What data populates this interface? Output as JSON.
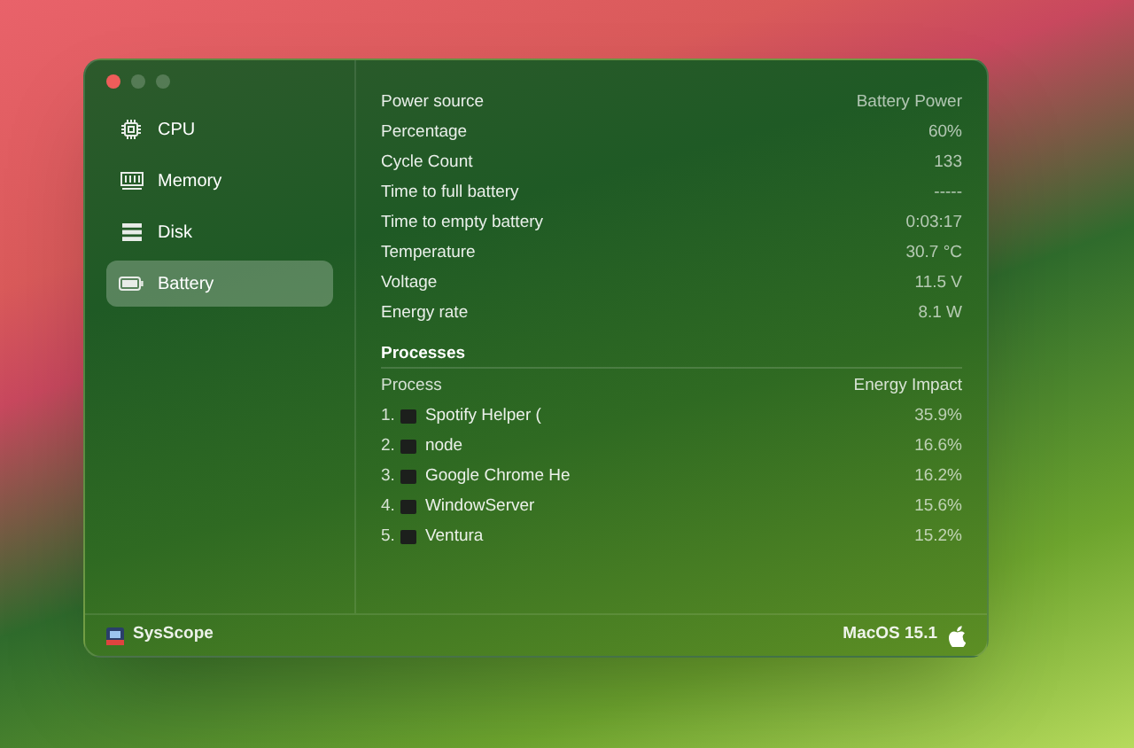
{
  "sidebar": {
    "items": [
      {
        "label": "CPU",
        "kind": "cpu",
        "selected": false
      },
      {
        "label": "Memory",
        "kind": "memory",
        "selected": false
      },
      {
        "label": "Disk",
        "kind": "disk",
        "selected": false
      },
      {
        "label": "Battery",
        "kind": "battery",
        "selected": true
      }
    ]
  },
  "battery_info": [
    {
      "label": "Power source",
      "value": "Battery Power"
    },
    {
      "label": "Percentage",
      "value": "60%"
    },
    {
      "label": "Cycle Count",
      "value": "133"
    },
    {
      "label": "Time to full battery",
      "value": "-----"
    },
    {
      "label": "Time to empty battery",
      "value": "0:03:17"
    },
    {
      "label": "Temperature",
      "value": "30.7 °C"
    },
    {
      "label": "Voltage",
      "value": "11.5 V"
    },
    {
      "label": "Energy rate",
      "value": "8.1 W"
    }
  ],
  "processes": {
    "title": "Processes",
    "columns": [
      "Process",
      "Energy Impact"
    ],
    "rows": [
      {
        "rank": "1.",
        "name": "Spotify Helper (",
        "impact": "35.9%"
      },
      {
        "rank": "2.",
        "name": "node",
        "impact": "16.6%"
      },
      {
        "rank": "3.",
        "name": "Google Chrome He",
        "impact": "16.2%"
      },
      {
        "rank": "4.",
        "name": "WindowServer",
        "impact": "15.6%"
      },
      {
        "rank": "5.",
        "name": "Ventura",
        "impact": "15.2%"
      }
    ]
  },
  "footer": {
    "app_name": "SysScope",
    "os_version": "MacOS 15.1"
  }
}
